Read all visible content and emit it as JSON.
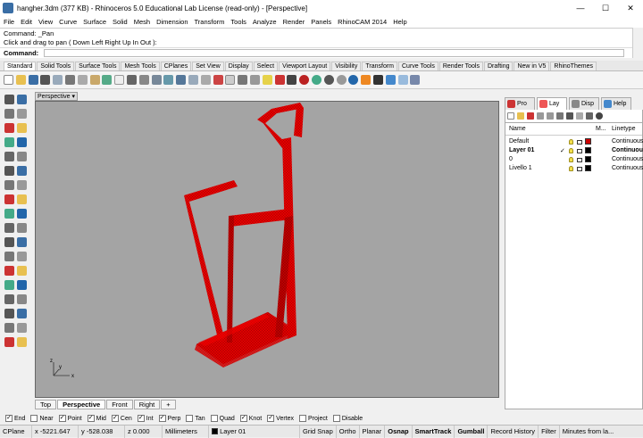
{
  "window": {
    "title": "hangher.3dm (377 KB) - Rhinoceros 5.0 Educational Lab License (read-only) - [Perspective]",
    "minimize_glyph": "—",
    "maximize_glyph": "☐",
    "close_glyph": "✕"
  },
  "menu": [
    "File",
    "Edit",
    "View",
    "Curve",
    "Surface",
    "Solid",
    "Mesh",
    "Dimension",
    "Transform",
    "Tools",
    "Analyze",
    "Render",
    "Panels",
    "RhinoCAM 2014",
    "Help"
  ],
  "command": {
    "history_line1": "Command: _Pan",
    "history_line2": "Click and drag to pan ( Down  Left  Right  Up  In  Out ):",
    "prompt_label": "Command:",
    "value": ""
  },
  "toolbar_tabs": [
    "Standard",
    "Solid Tools",
    "Surface Tools",
    "Mesh Tools",
    "CPlanes",
    "Set View",
    "Display",
    "Select",
    "Viewport Layout",
    "Visibility",
    "Transform",
    "Curve Tools",
    "Render Tools",
    "Drafting",
    "New in V5",
    "RhinoThemes"
  ],
  "viewport": {
    "title": "Perspective",
    "dropdown_glyph": "▾",
    "tabs": [
      "Top",
      "Perspective",
      "Front",
      "Right"
    ],
    "add_tab_glyph": "+",
    "axis_labels": {
      "x": "x",
      "y": "y",
      "z": "z"
    },
    "object_color": "#e00000",
    "background_color": "#a4a4a4"
  },
  "panel": {
    "tabs": [
      {
        "label": "Pro",
        "icon": "properties-icon"
      },
      {
        "label": "Lay",
        "icon": "layers-icon"
      },
      {
        "label": "Disp",
        "icon": "display-icon"
      },
      {
        "label": "Help",
        "icon": "help-icon"
      }
    ],
    "columns": {
      "name": "Name",
      "material": "M...",
      "linetype": "Linetype"
    },
    "layers": [
      {
        "name": "Default",
        "current": "",
        "color": "#cc0000",
        "linetype": "Continuous",
        "bold": false
      },
      {
        "name": "Layer 01",
        "current": "✓",
        "color": "#000000",
        "linetype": "Continuous",
        "bold": true
      },
      {
        "name": "0",
        "current": "",
        "color": "#000000",
        "linetype": "Continuous",
        "bold": false
      },
      {
        "name": "Livello 1",
        "current": "",
        "color": "#000000",
        "linetype": "Continuous",
        "bold": false
      }
    ]
  },
  "osnap": [
    {
      "label": "End",
      "checked": true
    },
    {
      "label": "Near",
      "checked": false
    },
    {
      "label": "Point",
      "checked": true
    },
    {
      "label": "Mid",
      "checked": true
    },
    {
      "label": "Cen",
      "checked": true
    },
    {
      "label": "Int",
      "checked": true
    },
    {
      "label": "Perp",
      "checked": true
    },
    {
      "label": "Tan",
      "checked": false
    },
    {
      "label": "Quad",
      "checked": false
    },
    {
      "label": "Knot",
      "checked": true
    },
    {
      "label": "Vertex",
      "checked": true
    },
    {
      "label": "Project",
      "checked": false
    },
    {
      "label": "Disable",
      "checked": false
    }
  ],
  "status": {
    "cplane": "CPlane",
    "x": "x -5221.647",
    "y": "y -528.038",
    "z": "z 0.000",
    "units": "Millimeters",
    "layer": "Layer 01",
    "layer_color": "#000000",
    "toggles": [
      {
        "label": "Grid Snap",
        "bold": false
      },
      {
        "label": "Ortho",
        "bold": false
      },
      {
        "label": "Planar",
        "bold": false
      },
      {
        "label": "Osnap",
        "bold": true
      },
      {
        "label": "SmartTrack",
        "bold": true
      },
      {
        "label": "Gumball",
        "bold": true
      },
      {
        "label": "Record History",
        "bold": false
      },
      {
        "label": "Filter",
        "bold": false
      }
    ],
    "message": "Minutes from la..."
  }
}
